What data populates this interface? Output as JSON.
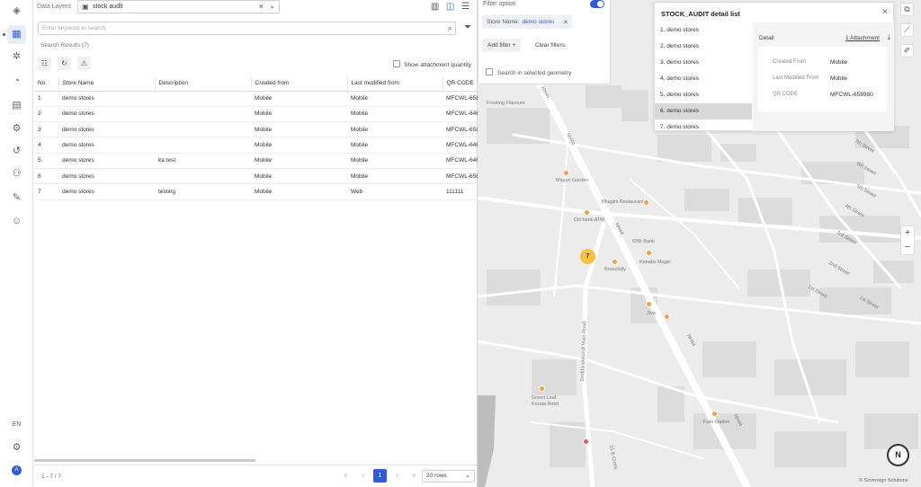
{
  "panel": {
    "data_layers_label": "Data Layers",
    "selected_layer": "stock audit",
    "search_placeholder": "Enter keyword to search",
    "search_results": "Search Results (7)",
    "show_attachment_quantity": "Show attachment quantity",
    "columns": [
      "No.",
      "Store Name",
      "Description",
      "Created from",
      "Last modified from",
      "QR CODE"
    ],
    "rows": [
      [
        "1",
        "demo stores",
        "",
        "Mobile",
        "Mobile",
        "MFCWL-658"
      ],
      [
        "2",
        "demo stores",
        "",
        "Mobile",
        "Mobile",
        "MFCWL-646"
      ],
      [
        "3",
        "demo stores",
        "",
        "Mobile",
        "Mobile",
        "MFCWL-658"
      ],
      [
        "4",
        "demo stores",
        "",
        "Mobile",
        "Mobile",
        "MFCWL-646"
      ],
      [
        "5",
        "demo stores",
        "ka test",
        "Mobile",
        "Mobile",
        "MFCWL-646"
      ],
      [
        "6",
        "demo stores",
        "",
        "Mobile",
        "Mobile",
        "MFCWL-658"
      ],
      [
        "7",
        "demo stores",
        "testing",
        "Mobile",
        "Web",
        "111111"
      ]
    ],
    "pagination_count": "1 - 7 / 7",
    "current_page": "1",
    "rows_per_page": "20 rows"
  },
  "filter": {
    "title": "Filter option",
    "chip_key": "Store Name:",
    "chip_value": "demo stores",
    "add_filter": "Add filter  +",
    "clear_filters": "Clear filters",
    "search_in_geometry": "Search in selected geometry"
  },
  "detail": {
    "title": "STOCK_AUDIT detail list",
    "items": [
      "1. demo stores",
      "2. demo stores",
      "3. demo stores",
      "4. demo stores",
      "5. demo stores",
      "6. demo stores",
      "7. demo stores"
    ],
    "selected_index": 5,
    "detail_label": "Detail",
    "attachment": "1 Attachment",
    "fields": [
      {
        "label": "Created From",
        "value": "Mobile"
      },
      {
        "label": "Last Modified From",
        "value": "Mobile"
      },
      {
        "label": "QR CODE",
        "value": "MFCWL-658980"
      }
    ]
  },
  "map": {
    "cluster_count": "7",
    "labels": {
      "frosting": "Frosting Flavours",
      "mayuri": "Mayuri Garden",
      "bhagini": "Bhagini Restaurant",
      "citibank": "Citi bank ATM",
      "idbi": "IDBI Bank",
      "kababs": "Kababs Magic",
      "brunchilly": "Brunchilly",
      "jiva": "Jiva",
      "greenleaf": "Green Leaf Kerala Hotel",
      "fuel": "Fuel Station",
      "nh44_1": "NH44",
      "nh44_2": "NH44",
      "nh44_3": "NH44",
      "nh44_4": "NH44",
      "nh44_5": "NH44",
      "doddanekkundi": "Doddanekkundi Main Road",
      "cross21b": "21 B Cross",
      "street7": "7th Street",
      "street6": "6th Street",
      "street5": "5th Street",
      "street4": "4th Street",
      "street3": "3rd Street",
      "street2": "2nd Street",
      "street1a": "1st Street",
      "street1b": "1st Street"
    },
    "compass": "N",
    "credit": "© Sovereign Solutions",
    "colors": {
      "accent": "#2f5bd6",
      "cluster": "#f7c33e",
      "poi": "#f0a24a"
    }
  }
}
